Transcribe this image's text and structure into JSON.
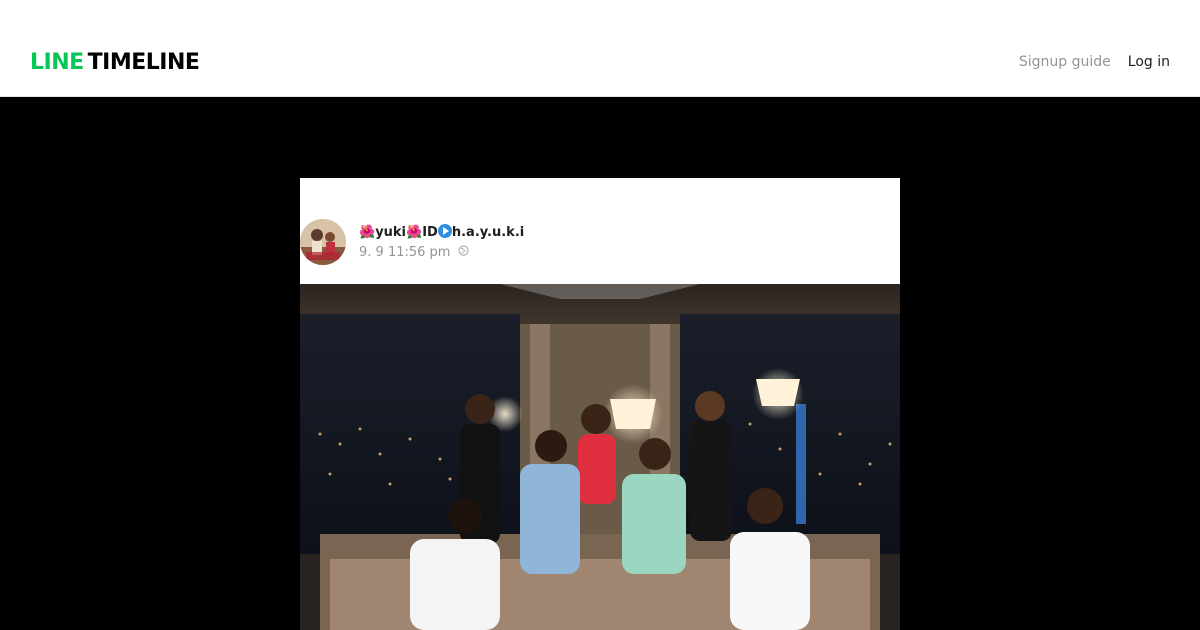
{
  "header": {
    "logo_line": "LINE",
    "logo_timeline": "TIMELINE",
    "signup_label": "Signup guide",
    "login_label": "Log in"
  },
  "post": {
    "author_flower": "🌺",
    "author_name_1": "yuki",
    "author_id_label": "ID",
    "author_name_2": "h.a.y.u.k.i",
    "timestamp": "9. 9 11:56 pm",
    "visibility_icon": "globe-icon"
  },
  "colors": {
    "brand_green": "#06c755",
    "stage_bg": "#000000"
  }
}
